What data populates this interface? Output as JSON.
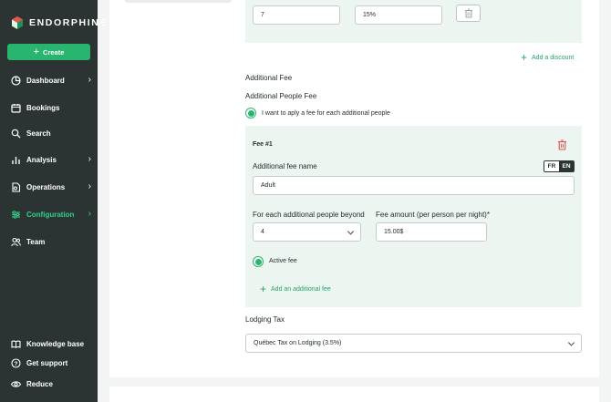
{
  "sidebar": {
    "brand": "ENDORPHINE",
    "create_label": "Create",
    "nav": [
      {
        "label": "Dashboard",
        "icon": "pie-chart-icon",
        "has_chevron": true
      },
      {
        "label": "Bookings",
        "icon": "calendar-icon",
        "has_chevron": false
      },
      {
        "label": "Search",
        "icon": "search-icon",
        "has_chevron": false
      },
      {
        "label": "Analysis",
        "icon": "bar-chart-icon",
        "has_chevron": true
      },
      {
        "label": "Operations",
        "icon": "document-icon",
        "has_chevron": true
      },
      {
        "label": "Configuration",
        "icon": "sliders-icon",
        "has_chevron": true,
        "active": true
      },
      {
        "label": "Team",
        "icon": "users-icon",
        "has_chevron": false
      }
    ],
    "footer": [
      {
        "label": "Knowledge base",
        "icon": "book-icon"
      },
      {
        "label": "Get support",
        "icon": "help-icon"
      },
      {
        "label": "Reduce",
        "icon": "eye-icon"
      }
    ]
  },
  "discount": {
    "value_1": "7",
    "value_2": "15%",
    "add_label": "Add a discount"
  },
  "additional_fee": {
    "heading": "Additional Fee",
    "people_heading": "Additional People Fee",
    "checkbox_label": "I want to aply a fee for each additional people",
    "fee_title": "Fee #1",
    "name_label": "Additional fee name",
    "lang_fr": "FR",
    "lang_en": "EN",
    "name_value": "Adult",
    "beyond_label": "For each additional people beyond",
    "beyond_value": "4",
    "amount_label": "Fee amount (per person per night)*",
    "amount_value": "15.00$",
    "active_label": "Active fee",
    "add_fee_label": "Add an additional fee"
  },
  "lodging_tax": {
    "label": "Lodging Tax",
    "value": "Québec Tax on Lodging (3.5%)"
  },
  "colors": {
    "sidebar_bg": "#2b3432",
    "accent": "#27b56f",
    "active_nav": "#2fd08a",
    "panel_bg": "#edf5f1",
    "delete_red": "#e0524f"
  }
}
